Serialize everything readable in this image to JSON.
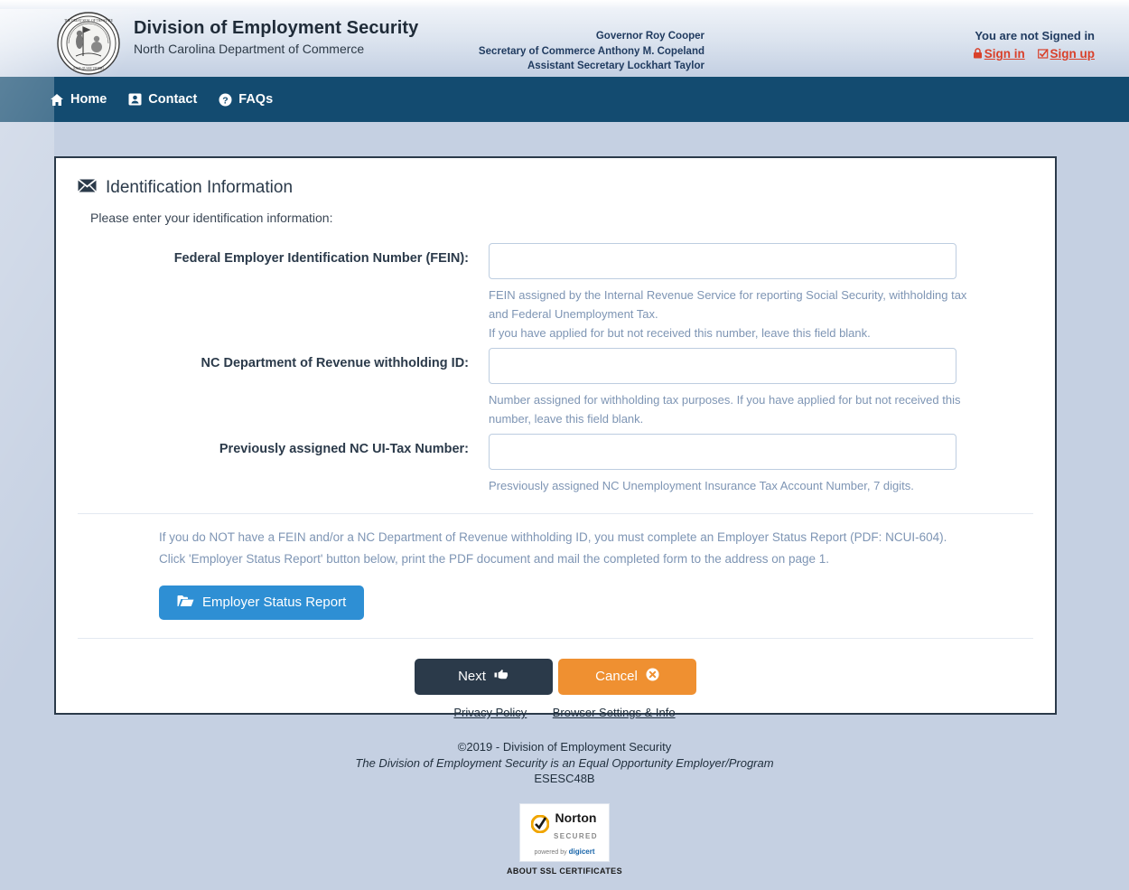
{
  "header": {
    "agency_title": "Division of Employment Security",
    "agency_sub": "North Carolina Department of Commerce",
    "seal_icon": "nc-state-seal",
    "officials": [
      "Governor Roy Cooper",
      "Secretary of Commerce Anthony M. Copeland",
      "Assistant Secretary Lockhart Taylor"
    ],
    "signin_status": "You are not Signed in",
    "signin_label": "Sign in",
    "signin_icon": "lock-icon",
    "signup_label": "Sign up",
    "signup_icon": "check-square-icon"
  },
  "nav": {
    "items": [
      {
        "label": "Home",
        "icon": "home-icon"
      },
      {
        "label": "Contact",
        "icon": "address-card-icon"
      },
      {
        "label": "FAQs",
        "icon": "question-circle-icon"
      }
    ]
  },
  "card": {
    "title": "Identification Information",
    "title_icon": "envelope-icon",
    "intro": "Please enter your identification information:",
    "fields": [
      {
        "label": "Federal Employer Identification Number (FEIN):",
        "value": "",
        "placeholder": "",
        "help": [
          "FEIN assigned by the Internal Revenue Service for reporting Social Security, withholding tax",
          "and Federal Unemployment Tax.",
          "If you have applied for but not received this number, leave this field blank."
        ]
      },
      {
        "label": "NC Department of Revenue withholding ID:",
        "value": "",
        "placeholder": "",
        "help": [
          "Number assigned for withholding tax purposes. If you have applied for but not received this",
          "number, leave this field blank."
        ]
      },
      {
        "label": "Previously assigned NC UI-Tax Number:",
        "value": "",
        "placeholder": "",
        "help": [
          "Presviously assigned NC Unemployment Insurance Tax Account Number, 7 digits."
        ]
      }
    ],
    "note_line1": "If you do NOT have a FEIN and/or a NC Department of Revenue withholding ID, you must complete an Employer Status Report (PDF: NCUI-604).",
    "note_line2": "Click 'Employer Status Report' button below, print the PDF document and mail the completed form to the address on page 1.",
    "esr_button": "Employer Status Report",
    "esr_icon": "folder-open-icon",
    "next_button": "Next",
    "next_icon": "hand-point-right-icon",
    "cancel_button": "Cancel",
    "cancel_icon": "times-circle-icon"
  },
  "footer": {
    "privacy_policy": "Privacy Policy",
    "browser_settings": "Browser Settings & Info",
    "copyright": "©2019 - Division of Employment Security",
    "eeo": "The Division of Employment Security is an Equal Opportunity Employer/Program",
    "code": "ESESC48B",
    "norton_word": "Norton",
    "norton_secured": "SECURED",
    "norton_powered": "powered by",
    "norton_brand": "digicert",
    "ssl_caption": "ABOUT SSL CERTIFICATES"
  },
  "colors": {
    "nav_blue": "#134b70",
    "page_bg": "#c5d0e2",
    "link_red": "#d9402a",
    "primary_blue": "#2e8fd4",
    "cancel_orange": "#ef9031",
    "dark_navy": "#2b3a4a"
  }
}
